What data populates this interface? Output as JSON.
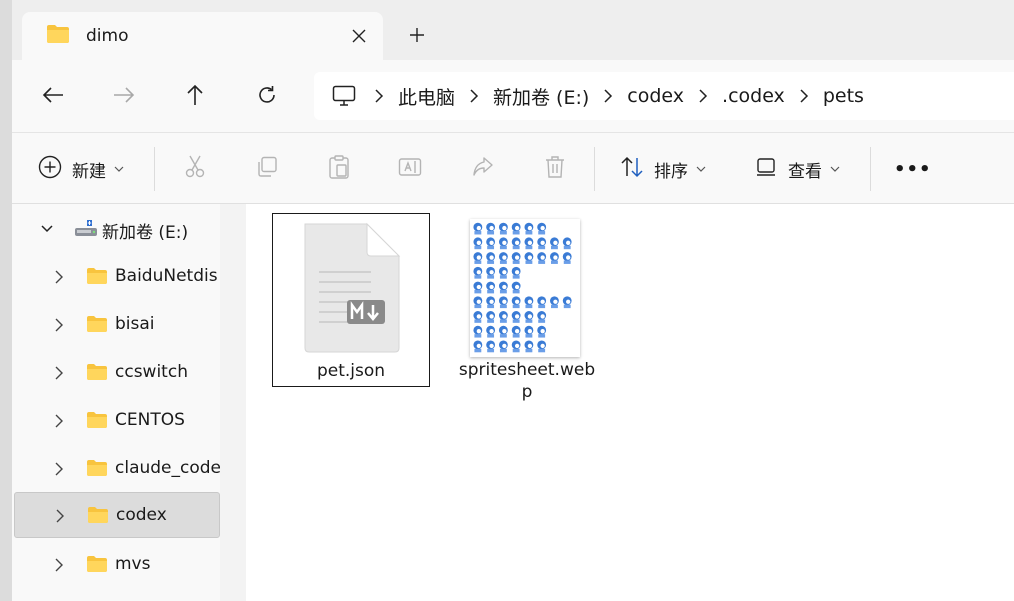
{
  "tab": {
    "title": "dimo"
  },
  "address": {
    "crumbs": [
      "此电脑",
      "新加卷 (E:)",
      "codex",
      ".codex",
      "pets"
    ]
  },
  "toolbar": {
    "new_label": "新建",
    "sort_label": "排序",
    "view_label": "查看",
    "more_label": "•••"
  },
  "sidebar": {
    "drive": {
      "label": "新加卷 (E:)"
    },
    "items": [
      {
        "label": "BaiduNetdis"
      },
      {
        "label": "bisai"
      },
      {
        "label": "ccswitch"
      },
      {
        "label": "CENTOS"
      },
      {
        "label": "claude_code"
      },
      {
        "label": "codex",
        "selected": true
      },
      {
        "label": "mvs"
      }
    ]
  },
  "files": [
    {
      "name": "pet.json",
      "icon": "markdown-file-icon",
      "selected": true
    },
    {
      "name_line1": "spritesheet.web",
      "name_line2": "p",
      "icon": "spritesheet-thumbnail"
    }
  ],
  "colors": {
    "folder": "#f8c43e",
    "sprite": "#3a7bd5"
  }
}
